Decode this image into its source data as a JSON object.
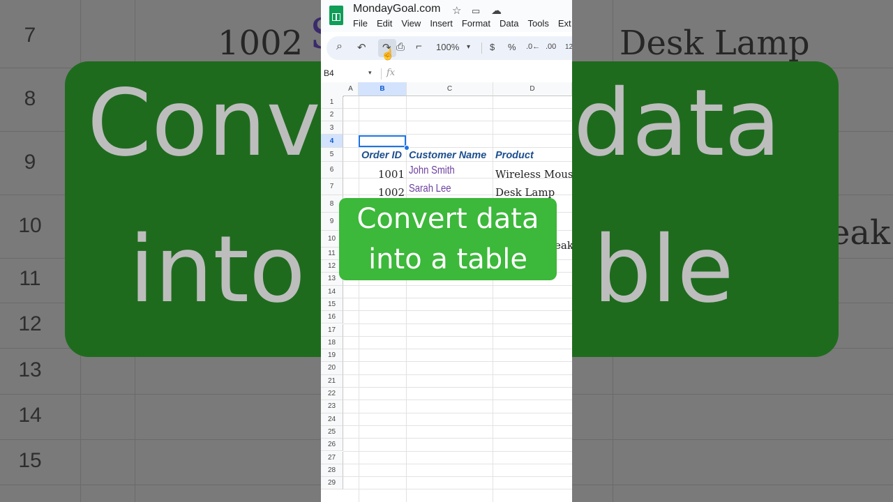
{
  "background": {
    "row_numbers": [
      "7",
      "8",
      "9",
      "10",
      "11",
      "12",
      "13",
      "14",
      "15"
    ],
    "cell_order_id": "1002",
    "cell_letter": "S",
    "cell_product": "Desk Lamp",
    "cell_partial": "eak",
    "banner_line1_left": "Conv",
    "banner_line1_right": "data",
    "banner_line2_left": "into",
    "banner_line2_right": "ble"
  },
  "titlebar": {
    "doc_title": "MondayGoal.com",
    "star_icon": "☆",
    "folder_icon": "▭",
    "cloud_icon": "☁"
  },
  "menu": {
    "file": "File",
    "edit": "Edit",
    "view": "View",
    "insert": "Insert",
    "format": "Format",
    "data": "Data",
    "tools": "Tools",
    "extensions": "Ext"
  },
  "toolbar": {
    "search_icon": "⌕",
    "undo_icon": "↶",
    "redo_icon": "↷",
    "print_icon": "⎙",
    "paint_format_icon": "⌐",
    "zoom": "100%",
    "zoom_caret": "▾",
    "currency": "$",
    "percent": "%",
    "decrease_decimal": ".0←",
    "increase_decimal": ".00",
    "more_formats": "12"
  },
  "formula_bar": {
    "name_box": "B4",
    "name_box_caret": "▾",
    "fx": "fx"
  },
  "grid": {
    "columns": [
      "A",
      "B",
      "C",
      "D"
    ],
    "rows": [
      "1",
      "2",
      "3",
      "4",
      "5",
      "6",
      "7",
      "8",
      "9",
      "10",
      "11",
      "12",
      "13",
      "14",
      "15",
      "16",
      "17",
      "18",
      "19",
      "20",
      "21",
      "22",
      "23",
      "24",
      "25",
      "26",
      "27",
      "28",
      "29"
    ],
    "headers": {
      "order_id": "Order ID",
      "customer_name": "Customer Name",
      "product": "Product"
    },
    "data_rows": [
      {
        "order_id": "1001",
        "customer": "John Smith",
        "product": "Wireless Mouse"
      },
      {
        "order_id": "1002",
        "customer": "Sarah Lee",
        "product": "Desk Lamp"
      }
    ],
    "partial_row10": "eak"
  },
  "caption": {
    "line1": "Convert data",
    "line2": "into a table",
    "color": "#3cb83a"
  },
  "colors": {
    "accent": "#1a73e8",
    "sheets_green": "#0f9d58",
    "header_text": "#1c4f8f",
    "name_text": "#6b3fa0"
  }
}
